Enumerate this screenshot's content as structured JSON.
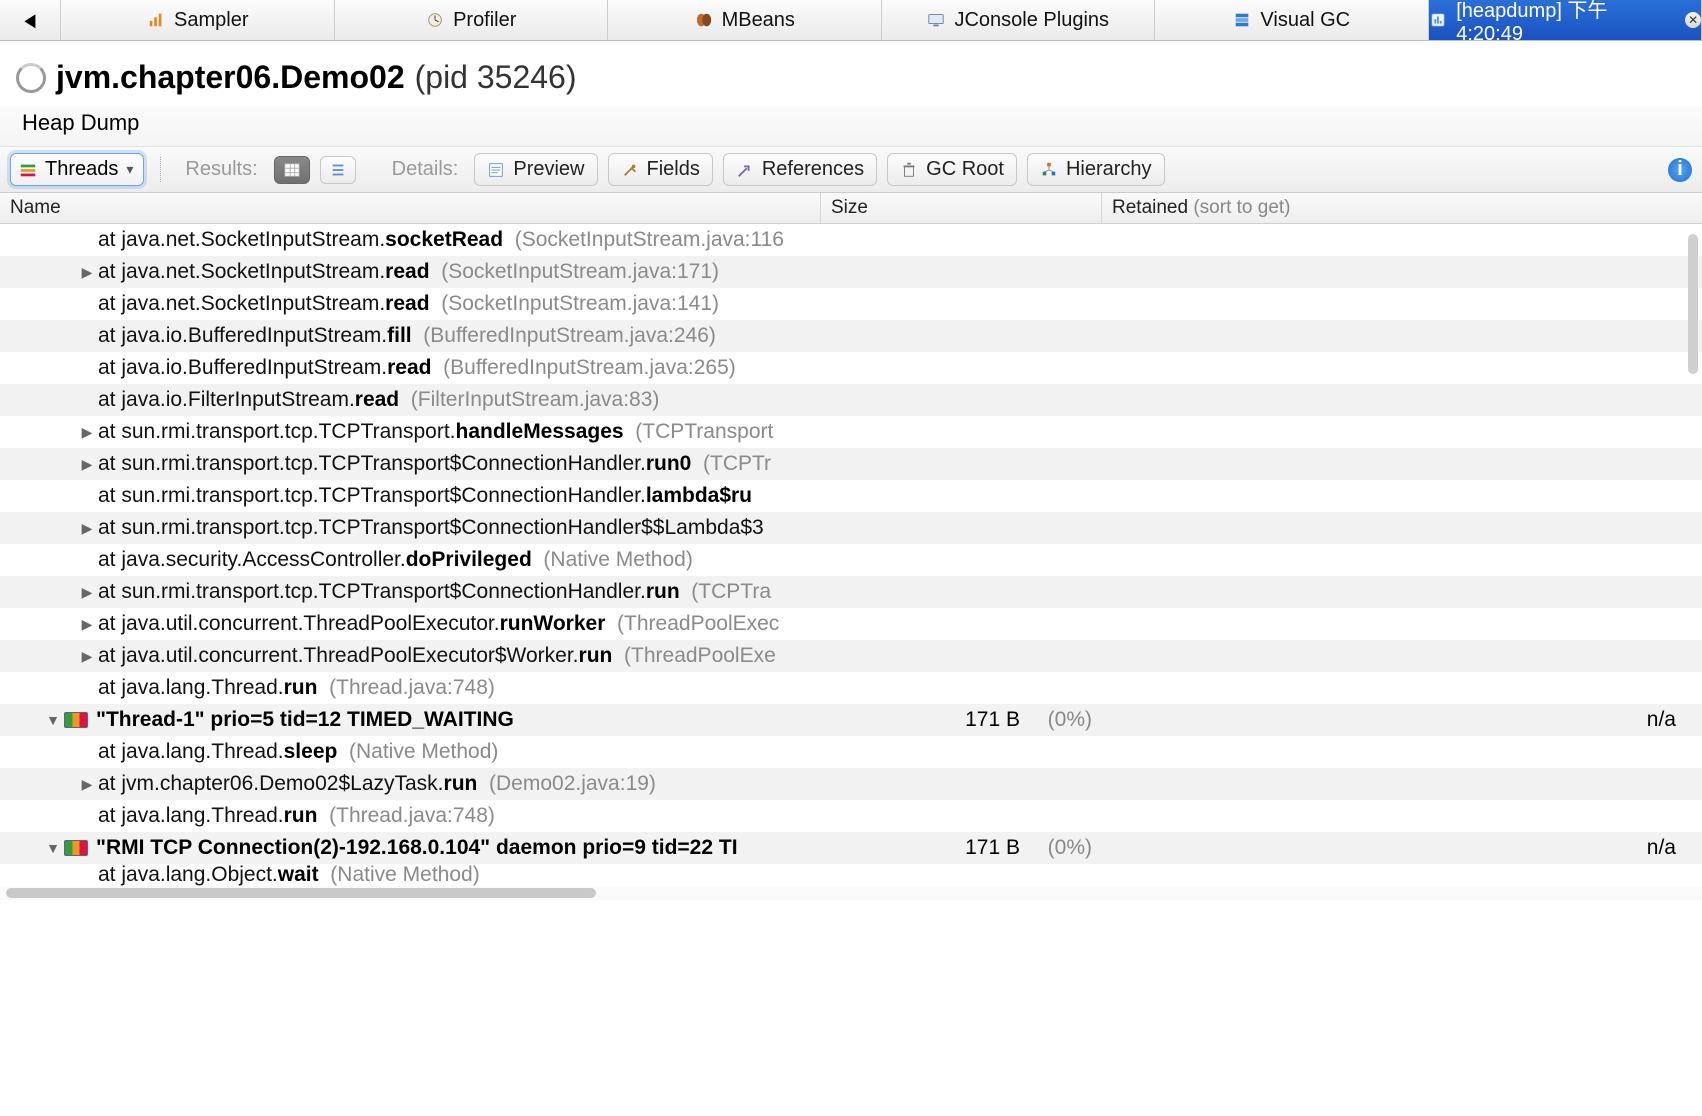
{
  "tabs": {
    "items": [
      {
        "label": "Sampler"
      },
      {
        "label": "Profiler"
      },
      {
        "label": "MBeans"
      },
      {
        "label": "JConsole Plugins"
      },
      {
        "label": "Visual GC"
      },
      {
        "label": "[heapdump] 下午4:20:49",
        "active": true
      }
    ]
  },
  "app": {
    "title_pkg": "jvm.chapter06.Demo02",
    "pid_text": "(pid 35246)",
    "subheader": "Heap Dump"
  },
  "toolbar": {
    "view_selector": "Threads",
    "results_label": "Results:",
    "details_label": "Details:",
    "preview": "Preview",
    "fields": "Fields",
    "references": "References",
    "gcroot": "GC Root",
    "hierarchy": "Hierarchy"
  },
  "columns": {
    "name": "Name",
    "size": "Size",
    "retained": "Retained",
    "retained_hint": "(sort to get)"
  },
  "rows": [
    {
      "type": "stack",
      "expand": "none",
      "pkg": "at java.net.SocketInputStream.",
      "method": "socketRead",
      "loc": "(SocketInputStream.java:116",
      "alt": false
    },
    {
      "type": "stack",
      "expand": "closed",
      "pkg": "at java.net.SocketInputStream.",
      "method": "read",
      "loc": "(SocketInputStream.java:171)",
      "alt": true
    },
    {
      "type": "stack",
      "expand": "none",
      "pkg": "at java.net.SocketInputStream.",
      "method": "read",
      "loc": "(SocketInputStream.java:141)",
      "alt": false
    },
    {
      "type": "stack",
      "expand": "none",
      "pkg": "at java.io.BufferedInputStream.",
      "method": "fill",
      "loc": "(BufferedInputStream.java:246)",
      "alt": true
    },
    {
      "type": "stack",
      "expand": "none",
      "pkg": "at java.io.BufferedInputStream.",
      "method": "read",
      "loc": "(BufferedInputStream.java:265)",
      "alt": false
    },
    {
      "type": "stack",
      "expand": "none",
      "pkg": "at java.io.FilterInputStream.",
      "method": "read",
      "loc": "(FilterInputStream.java:83)",
      "alt": true
    },
    {
      "type": "stack",
      "expand": "closed",
      "pkg": "at sun.rmi.transport.tcp.TCPTransport.",
      "method": "handleMessages",
      "loc": "(TCPTransport",
      "alt": false
    },
    {
      "type": "stack",
      "expand": "closed",
      "pkg": "at sun.rmi.transport.tcp.TCPTransport$ConnectionHandler.",
      "method": "run0",
      "loc": "(TCPTr",
      "alt": true
    },
    {
      "type": "stack",
      "expand": "none",
      "pkg": "at sun.rmi.transport.tcp.TCPTransport$ConnectionHandler.",
      "method": "lambda$ru",
      "loc": "",
      "alt": false
    },
    {
      "type": "stack",
      "expand": "closed",
      "pkg": "at sun.rmi.transport.tcp.TCPTransport$ConnectionHandler$$Lambda$3",
      "method": "",
      "loc": "",
      "alt": true
    },
    {
      "type": "stack",
      "expand": "none",
      "pkg": "at java.security.AccessController.",
      "method": "doPrivileged",
      "loc": "(Native Method)",
      "alt": false
    },
    {
      "type": "stack",
      "expand": "closed",
      "pkg": "at sun.rmi.transport.tcp.TCPTransport$ConnectionHandler.",
      "method": "run",
      "loc": "(TCPTra",
      "alt": true
    },
    {
      "type": "stack",
      "expand": "closed",
      "pkg": "at java.util.concurrent.ThreadPoolExecutor.",
      "method": "runWorker",
      "loc": "(ThreadPoolExec",
      "alt": false
    },
    {
      "type": "stack",
      "expand": "closed",
      "pkg": "at java.util.concurrent.ThreadPoolExecutor$Worker.",
      "method": "run",
      "loc": "(ThreadPoolExe",
      "alt": true
    },
    {
      "type": "stack",
      "expand": "none",
      "pkg": "at java.lang.Thread.",
      "method": "run",
      "loc": "(Thread.java:748)",
      "alt": false
    },
    {
      "type": "thread",
      "expand": "open",
      "label": "\"Thread-1\" prio=5 tid=12 TIMED_WAITING",
      "size": "171 B",
      "pct": "(0%)",
      "ret": "n/a",
      "alt": true
    },
    {
      "type": "stack",
      "expand": "none",
      "pkg": "at java.lang.Thread.",
      "method": "sleep",
      "loc": "(Native Method)",
      "alt": false
    },
    {
      "type": "stack",
      "expand": "closed",
      "pkg": "at jvm.chapter06.Demo02$LazyTask.",
      "method": "run",
      "loc": "(Demo02.java:19)",
      "alt": true
    },
    {
      "type": "stack",
      "expand": "none",
      "pkg": "at java.lang.Thread.",
      "method": "run",
      "loc": "(Thread.java:748)",
      "alt": false
    },
    {
      "type": "thread",
      "expand": "open",
      "label": "\"RMI TCP Connection(2)-192.168.0.104\" daemon prio=9 tid=22 TI",
      "size": "171 B",
      "pct": "(0%)",
      "ret": "n/a",
      "alt": true
    },
    {
      "type": "stack",
      "expand": "none",
      "pkg": "at java.lang.Object.",
      "method": "wait",
      "loc": "(Native Method)",
      "alt": false,
      "cut": true
    }
  ]
}
